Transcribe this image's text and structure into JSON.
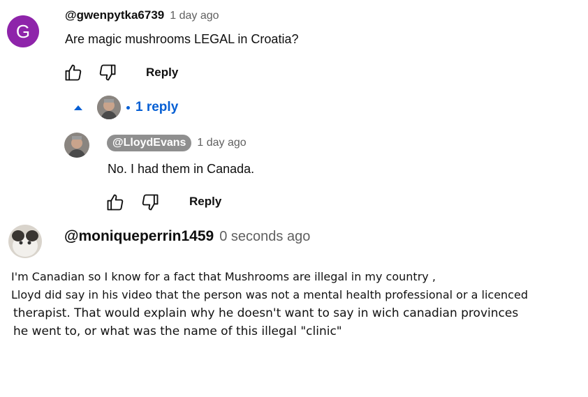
{
  "colors": {
    "avatar_g": "#8e24aa",
    "link_blue": "#065fd4",
    "handle_chip": "#8f8f8f",
    "muted": "#606060"
  },
  "comment1": {
    "avatar_letter": "G",
    "handle": "@gwenpytka6739",
    "time": "1 day ago",
    "text": "Are magic mushrooms LEGAL in Croatia?",
    "reply_label": "Reply",
    "icons": [
      "thumbs-up-icon",
      "thumbs-down-icon"
    ]
  },
  "replies_toggle": {
    "icon": "caret-up-icon",
    "label": "1 reply"
  },
  "reply1": {
    "handle": "@LloydEvans",
    "time": "1 day ago",
    "text": "No. I had them in Canada.",
    "reply_label": "Reply"
  },
  "comment2": {
    "handle": "@moniqueperrin1459",
    "time": "0 seconds ago",
    "lines": [
      "I'm Canadian so I know for a fact that Mushrooms are illegal in my country ,",
      "Lloyd did say in his video that the person was not a mental health professional or a licenced",
      "therapist. That would explain why he doesn't want to say in wich canadian provinces",
      "he went to, or what was the name of this illegal \"clinic\""
    ]
  }
}
